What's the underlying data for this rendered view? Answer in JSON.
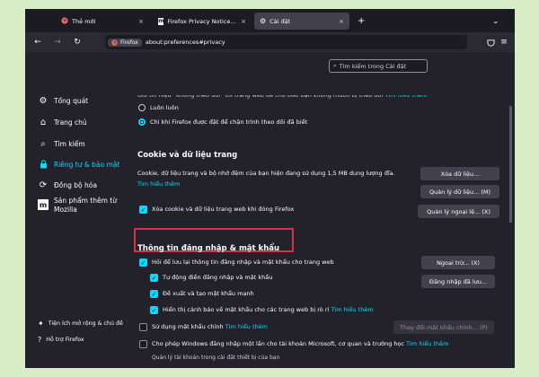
{
  "tabs": [
    {
      "icon": "firefox-icon",
      "title": "Thẻ mới",
      "close": "×"
    },
    {
      "icon": "mozilla-icon",
      "title": "Firefox Privacy Notice — Mozil",
      "close": "×"
    },
    {
      "icon": "gear-icon",
      "title": "Cài đặt",
      "close": "×"
    }
  ],
  "new_tab_label": "+",
  "tab_overflow": "⌄",
  "toolbar": {
    "back": "←",
    "forward": "→",
    "reload": "↻",
    "browser_label": "Firefox",
    "url": "about:preferences#privacy"
  },
  "search": {
    "placeholder": "Tìm kiếm trong Cài đặt"
  },
  "sidebar": {
    "items": [
      {
        "icon": "gear-icon",
        "label": "Tổng quát"
      },
      {
        "icon": "home-icon",
        "label": "Trang chủ"
      },
      {
        "icon": "search-icon",
        "label": "Tìm kiếm"
      },
      {
        "icon": "lock-icon",
        "label": "Riêng tư & bảo mật"
      },
      {
        "icon": "sync-icon",
        "label": "Đồng bộ hóa"
      },
      {
        "icon": "more-from-mozilla-icon",
        "label": "Sản phẩm thêm từ",
        "label2": "Mozilla"
      }
    ],
    "footer": [
      {
        "icon": "puzzle-icon",
        "label": "Tiện ích mở rộng & chủ đề"
      },
      {
        "icon": "help-icon",
        "label": "Hỗ trợ Firefox"
      }
    ]
  },
  "top_partial": {
    "text": "Gửi tín hiệu “Không theo dõi” tới trang web để cho biết bạn không muốn bị theo dõi",
    "link": "Tìm hiểu thêm"
  },
  "radios": [
    {
      "label": "Luôn luôn",
      "selected": false
    },
    {
      "label": "Chỉ khi Firefox được đặt để chặn trình theo dõi đã biết",
      "selected": true
    }
  ],
  "cookies": {
    "heading": "Cookie và dữ liệu trang",
    "desc": "Cookie, dữ liệu trang và bộ nhớ đệm của bạn hiện đang sử dụng 1,5 MB dung lượng đĩa.",
    "learn_more": "Tìm hiểu thêm",
    "clear_btn": "Xóa dữ liệu...",
    "manage_btn": "Quản lý dữ liệu... (M)",
    "exceptions_btn": "Quản lý ngoại lệ... (X)",
    "delete_on_close": "Xóa cookie và dữ liệu trang web khi đóng Firefox"
  },
  "logins": {
    "heading": "Thông tin đăng nhập & mật khẩu",
    "ask_save": "Hỏi để lưu lại thông tin đăng nhập và mật khẩu cho trang web",
    "autofill": "Tự động điền đăng nhập và mật khẩu",
    "suggest": "Đề xuất và tạo mật khẩu mạnh",
    "alerts": "Hiển thị cảnh báo về mật khẩu cho các trang web bị rò rỉ",
    "alerts_link": "Tìm hiểu thêm",
    "exceptions_btn": "Ngoại trừ... (X)",
    "saved_btn": "Đăng nhập đã lưu...",
    "primary": "Sử dụng mật khẩu chính",
    "primary_link": "Tìm hiểu thêm",
    "change_primary_btn": "Thay đổi mật khẩu chính... (P)",
    "windows_sso": "Cho phép Windows đăng nhập một lần cho tài khoản Microsoft, cơ quan và trường học",
    "windows_link": "Tìm hiểu thêm",
    "windows_sub": "Quản lý tài khoản trong cài đặt thiết bị của bạn"
  }
}
